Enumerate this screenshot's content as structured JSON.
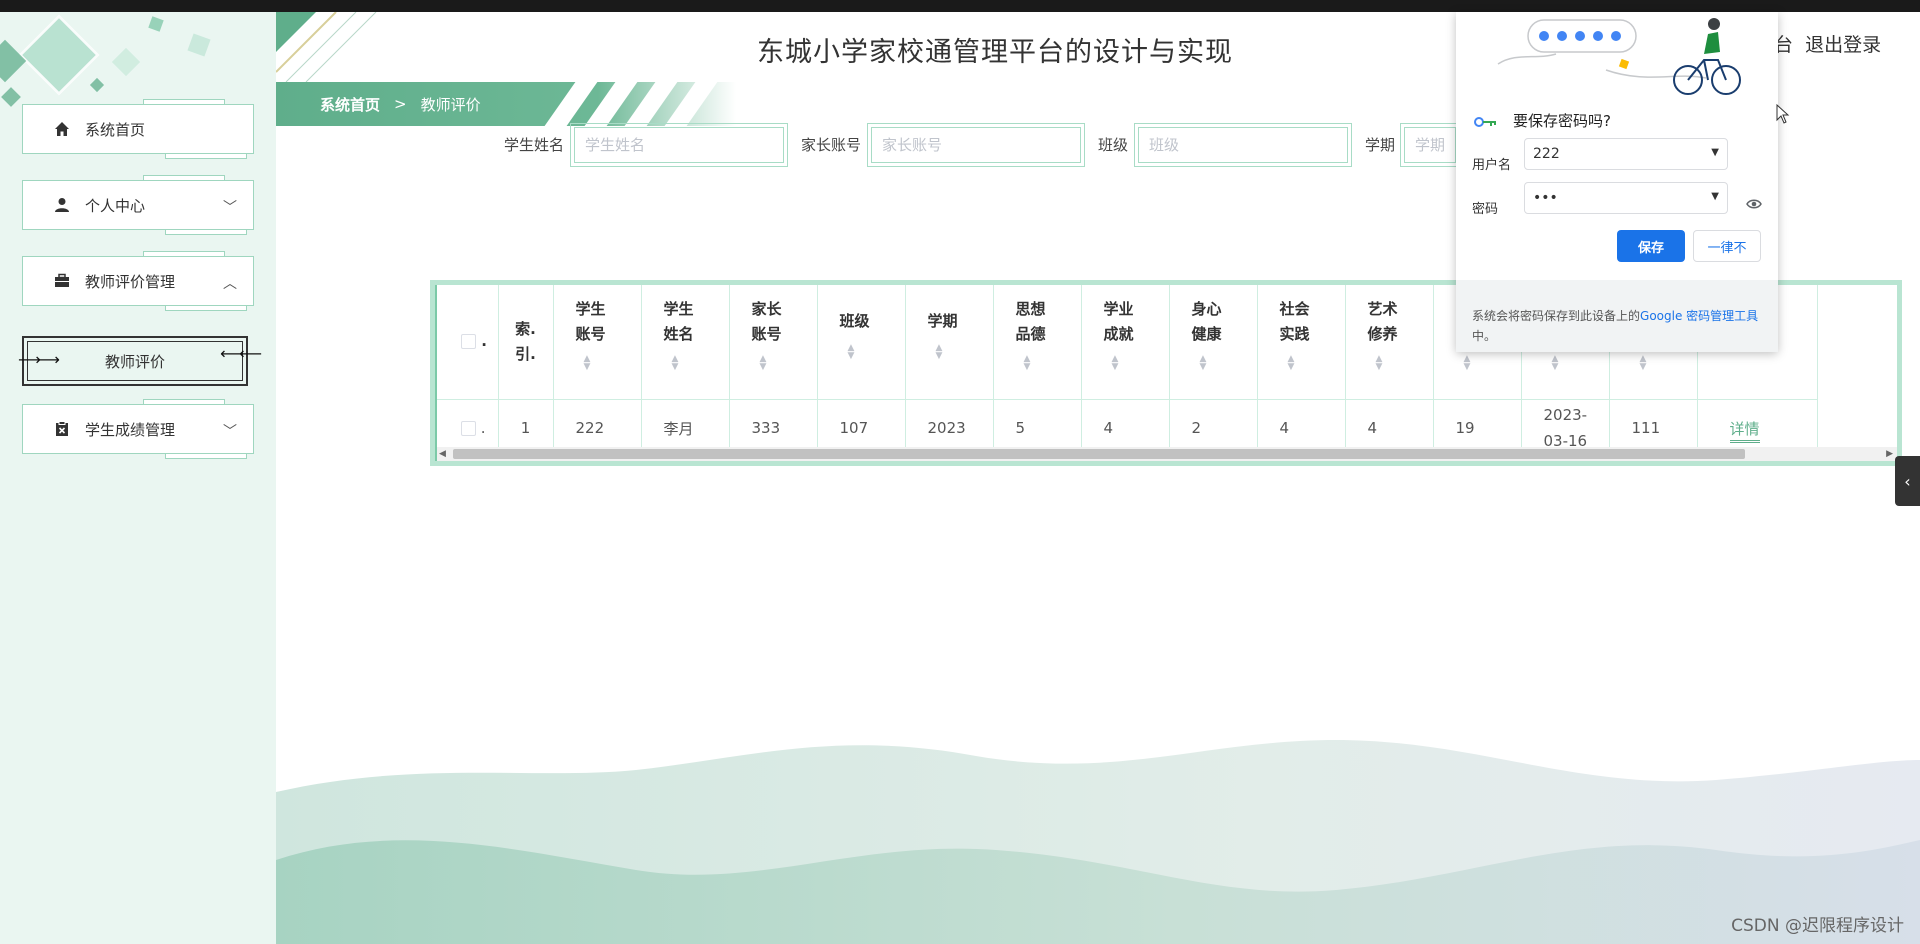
{
  "header": {
    "title": "东城小学家校通管理平台的设计与实现",
    "right_partial": "台",
    "logout": "退出登录"
  },
  "breadcrumb": {
    "home": "系统首页",
    "sep": ">",
    "current": "教师评价"
  },
  "sidebar": {
    "items": [
      {
        "label": "系统首页",
        "icon": "home-icon"
      },
      {
        "label": "个人中心",
        "icon": "user-icon",
        "chevron": "down"
      },
      {
        "label": "教师评价管理",
        "icon": "briefcase-icon",
        "chevron": "up"
      },
      {
        "label": "学生成绩管理",
        "icon": "clipboard-x-icon",
        "chevron": "down"
      }
    ],
    "subitem": "教师评价"
  },
  "search": {
    "fields": [
      {
        "label": "学生姓名",
        "placeholder": "学生姓名"
      },
      {
        "label": "家长账号",
        "placeholder": "家长账号"
      },
      {
        "label": "班级",
        "placeholder": "班级"
      },
      {
        "label": "学期",
        "placeholder": "学期"
      }
    ]
  },
  "table": {
    "headers": [
      "索.引.",
      "学生账号",
      "学生姓名",
      "家长账号",
      "班级",
      "学期",
      "思想品德",
      "学业成就",
      "身心健康",
      "社会实践",
      "艺术修养",
      "",
      "",
      "",
      ""
    ],
    "header_lines": [
      [
        "索.",
        "引."
      ],
      [
        "学生",
        "账号"
      ],
      [
        "学生",
        "姓名"
      ],
      [
        "家长",
        "账号"
      ],
      [
        "班级"
      ],
      [
        "学期"
      ],
      [
        "思想",
        "品德"
      ],
      [
        "学业",
        "成就"
      ],
      [
        "身心",
        "健康"
      ],
      [
        "社会",
        "实践"
      ],
      [
        "艺术",
        "修养"
      ]
    ],
    "rows": [
      {
        "index": "1",
        "student_account": "222",
        "student_name": "李月",
        "parent_account": "333",
        "class": "107",
        "term": "2023",
        "morality": "5",
        "academic": "4",
        "health": "2",
        "practice": "4",
        "art": "4",
        "total": "19",
        "date_line1": "2023-",
        "date_line2": "03-16",
        "teacher": "111",
        "action": "详情"
      }
    ]
  },
  "password_popup": {
    "title": "要保存密码吗?",
    "username_label": "用户名",
    "username_value": "222",
    "password_label": "密码",
    "password_value": "•••",
    "save": "保存",
    "never": "一律不",
    "footer_text": "系统会将密码保存到此设备上的",
    "footer_link": "Google 密码管理工具",
    "footer_end": "中。"
  },
  "watermark": "CSDN @迟限程序设计",
  "colors": {
    "accent": "#5fae8b",
    "light": "#eaf6f1",
    "border": "#a8dcc6",
    "google_blue": "#1a73e8"
  }
}
